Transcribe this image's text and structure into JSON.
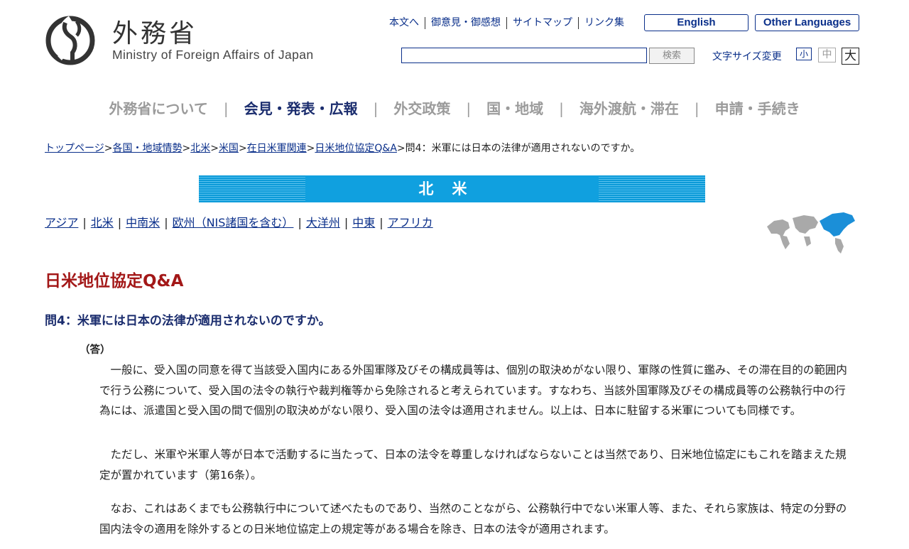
{
  "header": {
    "logo_title": "外務省",
    "logo_subtitle": "Ministry of Foreign Affairs of Japan",
    "utility_links": [
      "本文へ",
      "御意見・御感想",
      "サイトマップ",
      "リンク集"
    ],
    "lang_english": "English",
    "lang_other": "Other Languages",
    "search_value": "",
    "search_button": "検索",
    "font_size_label": "文字サイズ変更",
    "font_small": "小",
    "font_medium": "中",
    "font_large": "大"
  },
  "nav": {
    "items": [
      "外務省について",
      "会見・発表・広報",
      "外交政策",
      "国・地域",
      "海外渡航・滞在",
      "申請・手続き"
    ],
    "active_index": 1
  },
  "breadcrumb": {
    "links": [
      "トップページ",
      "各国・地域情勢",
      "北米",
      "米国",
      "在日米軍関連",
      "日米地位協定Q&A"
    ],
    "current": "問4：米軍には日本の法律が適用されないのですか。"
  },
  "banner": {
    "title": "北米"
  },
  "regions": [
    "アジア",
    "北米",
    "中南米",
    "欧州（NIS諸国を含む）",
    "大洋州",
    "中東",
    "アフリカ"
  ],
  "content": {
    "title": "日米地位協定Q&A",
    "question": "問4：米軍には日本の法律が適用されないのですか。",
    "answer_label": "（答）",
    "paragraphs": [
      "一般に、受入国の同意を得て当該受入国内にある外国軍隊及びその構成員等は、個別の取決めがない限り、軍隊の性質に鑑み、その滞在目的の範囲内で行う公務について、受入国の法令の執行や裁判権等から免除されると考えられています。すなわち、当該外国軍隊及びその構成員等の公務執行中の行為には、派遣国と受入国の間で個別の取決めがない限り、受入国の法令は適用されません。以上は、日本に駐留する米軍についても同様です。",
      "ただし、米軍や米軍人等が日本で活動するに当たって、日本の法令を尊重しなければならないことは当然であり、日米地位協定にもこれを踏まえた規定が置かれています（第16条）。",
      "なお、これはあくまでも公務執行中について述べたものであり、当然のことながら、公務執行中でない米軍人等、また、それら家族は、特定の分野の国内法令の適用を除外するとの日米地位協定上の規定等がある場合を除き、日本の法令が適用されます。"
    ]
  },
  "colors": {
    "brand_navy": "#1b2d6e",
    "link": "#0a2f8a",
    "title_red": "#a31818",
    "banner_blue": "#10a0df"
  }
}
